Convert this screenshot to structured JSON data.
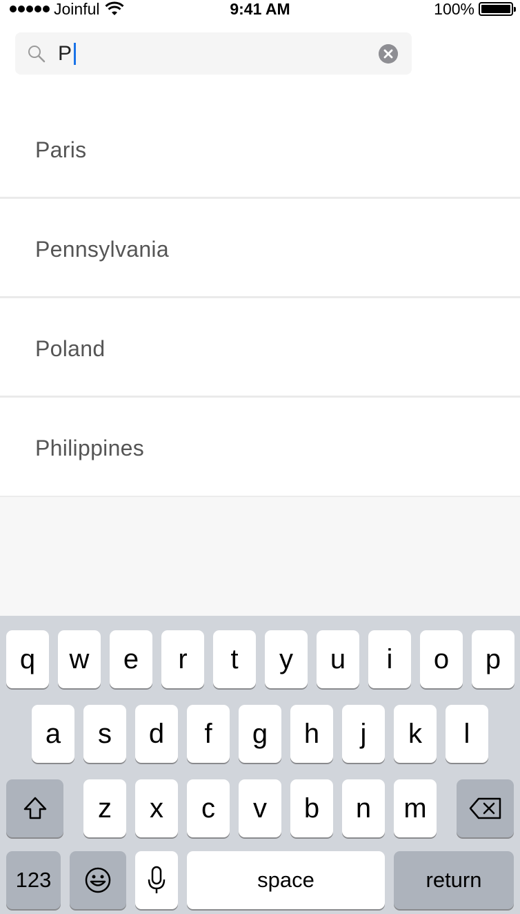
{
  "status_bar": {
    "carrier": "Joinful",
    "time": "9:41 AM",
    "battery": "100%"
  },
  "search": {
    "value": "P",
    "icon": "search-icon",
    "clear_icon": "clear-icon"
  },
  "results": [
    {
      "label": "Paris"
    },
    {
      "label": "Pennsylvania"
    },
    {
      "label": "Poland"
    },
    {
      "label": "Philippines"
    }
  ],
  "keyboard": {
    "row1": [
      "q",
      "w",
      "e",
      "r",
      "t",
      "y",
      "u",
      "i",
      "o",
      "p"
    ],
    "row2": [
      "a",
      "s",
      "d",
      "f",
      "g",
      "h",
      "j",
      "k",
      "l"
    ],
    "row3": [
      "z",
      "x",
      "c",
      "v",
      "b",
      "n",
      "m"
    ],
    "shift_icon": "shift-icon",
    "backspace_icon": "backspace-icon",
    "numbers_label": "123",
    "emoji_icon": "emoji-icon",
    "mic_icon": "microphone-icon",
    "space_label": "space",
    "return_label": "return"
  },
  "colors": {
    "caret": "#1a73e8",
    "keyboard_bg": "#d1d5db",
    "function_key": "#adb3bc"
  }
}
